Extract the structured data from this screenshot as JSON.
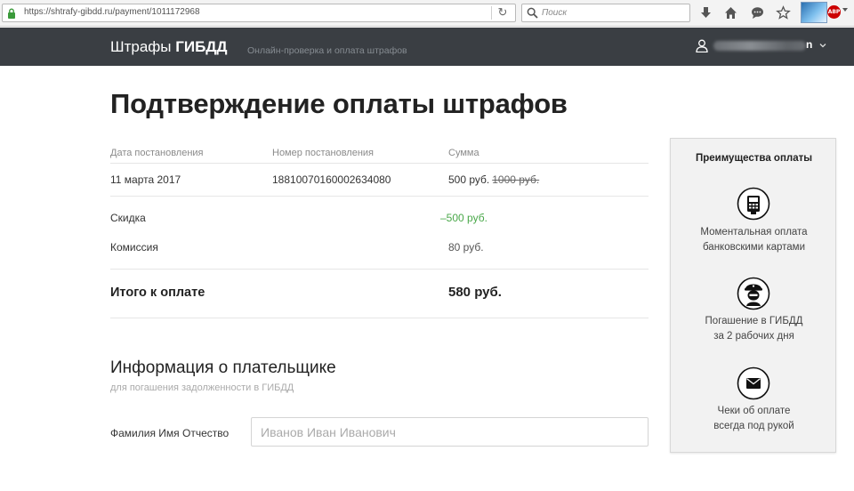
{
  "browser": {
    "url": "https://shtrafy-gibdd.ru/payment/1011172968",
    "search_placeholder": "Поиск",
    "extension_badge": "ABP"
  },
  "header": {
    "brand_regular": "Штрафы ",
    "brand_bold": "ГИБДД",
    "tagline": "Онлайн-проверка и оплата штрафов",
    "user_name_visible_tail": "n"
  },
  "page": {
    "title": "Подтверждение оплаты штрафов",
    "table": {
      "headers": [
        "Дата постановления",
        "Номер постановления",
        "Сумма"
      ],
      "row": {
        "date": "11 марта 2017",
        "number": "18810070160002634080",
        "amount": "500 руб.",
        "amount_old": "1000 руб."
      }
    },
    "discount_label": "Скидка",
    "discount_value": "–500 руб.",
    "commission_label": "Комиссия",
    "commission_value": "80 руб.",
    "total_label": "Итого к оплате",
    "total_value": "580 руб.",
    "payer_title": "Информация о плательщике",
    "payer_subtitle": "для погашения задолженности в ГИБДД",
    "fio_label": "Фамилия Имя Отчество",
    "fio_placeholder": "Иванов Иван Иванович"
  },
  "sidebar": {
    "title": "Преимущества оплаты",
    "benefits": [
      {
        "icon": "payment-terminal-icon",
        "line1": "Моментальная оплата",
        "line2": "банковскими картами"
      },
      {
        "icon": "traffic-police-icon",
        "line1": "Погашение в ГИБДД",
        "line2": "за 2 рабочих дня"
      },
      {
        "icon": "envelope-icon",
        "line1": "Чеки об оплате",
        "line2": "всегда под рукой"
      }
    ]
  },
  "colors": {
    "header_bg": "#3a3e43",
    "discount": "#4aa84a",
    "panel_bg": "#f2f2f2"
  }
}
